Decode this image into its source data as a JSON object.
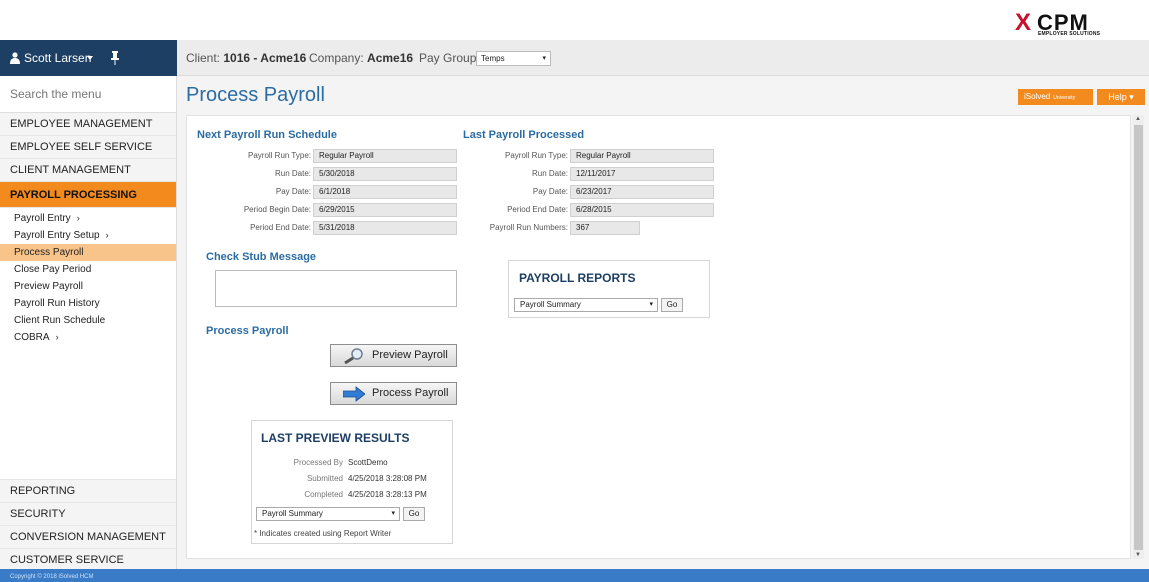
{
  "brand": {
    "logo_mark": "X",
    "logo_name": "CPM",
    "logo_sub": "EMPLOYER SOLUTIONS"
  },
  "header": {
    "user_name": "Scott Larsen",
    "client_label": "Client:",
    "client_value": "1016 - Acme16",
    "company_label": "Company:",
    "company_value": "Acme16",
    "paygroup_label": "Pay Group:",
    "paygroup_value": "Temps"
  },
  "sidebar": {
    "search_placeholder": "Search the menu",
    "top_items": [
      "EMPLOYEE MANAGEMENT",
      "EMPLOYEE SELF SERVICE",
      "CLIENT MANAGEMENT"
    ],
    "active_item": "PAYROLL PROCESSING",
    "sub_items": [
      {
        "label": "Payroll Entry",
        "chevron": "›"
      },
      {
        "label": "Payroll Entry Setup",
        "chevron": "›"
      },
      {
        "label": "Process Payroll",
        "chevron": ""
      },
      {
        "label": "Close Pay Period",
        "chevron": ""
      },
      {
        "label": "Preview Payroll",
        "chevron": ""
      },
      {
        "label": "Payroll Run History",
        "chevron": ""
      },
      {
        "label": "Client Run Schedule",
        "chevron": ""
      },
      {
        "label": "COBRA",
        "chevron": "›"
      }
    ],
    "bottom_items": [
      "REPORTING",
      "SECURITY",
      "CONVERSION MANAGEMENT",
      "CUSTOMER SERVICE"
    ]
  },
  "main": {
    "title": "Process Payroll",
    "isolved_label": "iSolved",
    "isolved_sub": "University",
    "help_label": "Help ▾",
    "next_run": {
      "title": "Next Payroll Run Schedule",
      "fields": [
        {
          "label": "Payroll Run Type:",
          "value": "Regular Payroll"
        },
        {
          "label": "Run Date:",
          "value": "5/30/2018"
        },
        {
          "label": "Pay Date:",
          "value": "6/1/2018"
        },
        {
          "label": "Period Begin Date:",
          "value": "6/29/2015"
        },
        {
          "label": "Period End Date:",
          "value": "5/31/2018"
        }
      ]
    },
    "last_run": {
      "title": "Last Payroll Processed",
      "fields": [
        {
          "label": "Payroll Run Type:",
          "value": "Regular Payroll"
        },
        {
          "label": "Run Date:",
          "value": "12/11/2017"
        },
        {
          "label": "Pay Date:",
          "value": "6/23/2017"
        },
        {
          "label": "Period End Date:",
          "value": "6/28/2015"
        },
        {
          "label": "Payroll Run Numbers:",
          "value": "367"
        }
      ]
    },
    "check_stub_title": "Check Stub Message",
    "process_title": "Process Payroll",
    "preview_button": "Preview Payroll",
    "process_button": "Process Payroll",
    "reports": {
      "title": "PAYROLL REPORTS",
      "selected": "Payroll Summary",
      "go": "Go"
    },
    "last_preview": {
      "title": "LAST PREVIEW RESULTS",
      "processed_by_label": "Processed By",
      "processed_by": "ScottDemo",
      "submitted_label": "Submitted",
      "submitted": "4/25/2018 3:28:08 PM",
      "completed_label": "Completed",
      "completed": "4/25/2018 3:28:13 PM",
      "selected": "Payroll Summary",
      "go": "Go",
      "note": "* Indicates created using Report Writer"
    }
  },
  "footer": {
    "copyright": "Copyright © 2018 iSolved HCM"
  },
  "colors": {
    "navy": "#1d3f63",
    "orange": "#f28a1e",
    "link_blue": "#2b6ca3",
    "footer_blue": "#3a7bc8"
  }
}
